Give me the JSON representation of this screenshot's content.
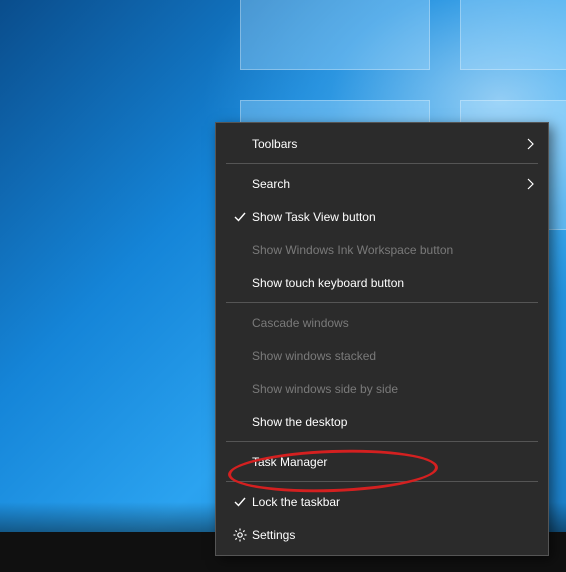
{
  "menu": {
    "toolbars": "Toolbars",
    "search": "Search",
    "show_task_view": "Show Task View button",
    "show_ink": "Show Windows Ink Workspace button",
    "show_touch_kb": "Show touch keyboard button",
    "cascade": "Cascade windows",
    "stacked": "Show windows stacked",
    "side_by_side": "Show windows side by side",
    "show_desktop": "Show the desktop",
    "task_manager": "Task Manager",
    "lock_taskbar": "Lock the taskbar",
    "settings": "Settings"
  }
}
